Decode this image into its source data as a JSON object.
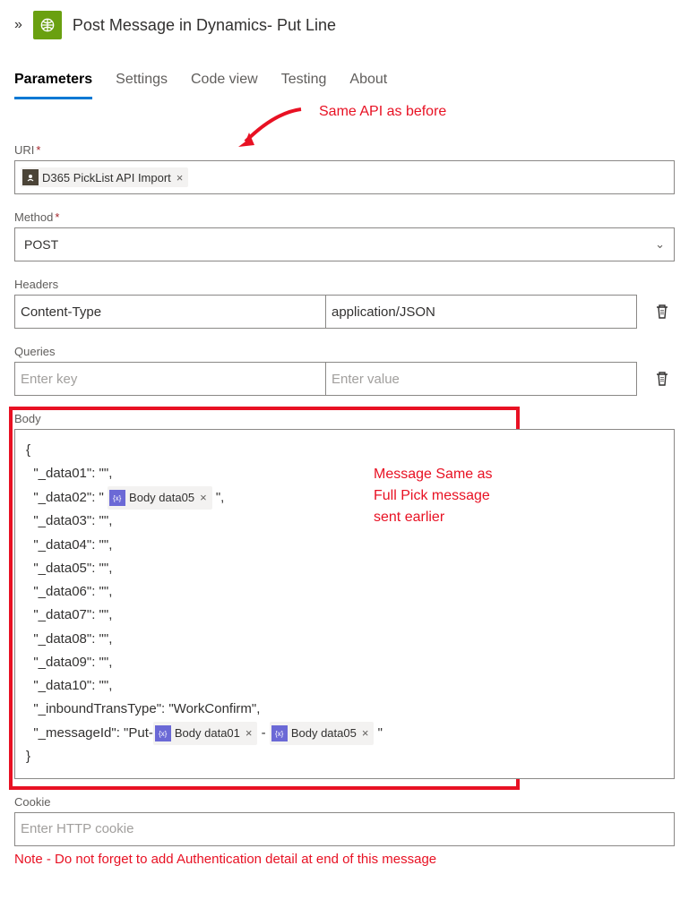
{
  "header": {
    "title": "Post Message in Dynamics- Put Line"
  },
  "tabs": [
    {
      "label": "Parameters",
      "active": true
    },
    {
      "label": "Settings",
      "active": false
    },
    {
      "label": "Code view",
      "active": false
    },
    {
      "label": "Testing",
      "active": false
    },
    {
      "label": "About",
      "active": false
    }
  ],
  "annotations": {
    "top": "Same API as before",
    "bodyLine1": "Message Same as",
    "bodyLine2": "Full Pick message",
    "bodyLine3": "sent earlier",
    "note": "Note - Do not forget to add Authentication detail at end of this message"
  },
  "fields": {
    "uri": {
      "label": "URI",
      "token": "D365 PickList API Import"
    },
    "method": {
      "label": "Method",
      "value": "POST"
    },
    "headers": {
      "label": "Headers",
      "key": "Content-Type",
      "value": "application/JSON"
    },
    "queries": {
      "label": "Queries",
      "keyPlaceholder": "Enter key",
      "valuePlaceholder": "Enter value"
    },
    "body": {
      "label": "Body",
      "lines": [
        "{",
        "  \"_data01\": \"\",",
        "  \"_data02\": \" ",
        "  \"_data03\": \"\",",
        "  \"_data04\": \"\",",
        "  \"_data05\": \"\",",
        "  \"_data06\": \"\",",
        "  \"_data07\": \"\",",
        "  \"_data08\": \"\",",
        "  \"_data09\": \"\",",
        "  \"_data10\": \"\",",
        "  \"_inboundTransType\": \"WorkConfirm\",",
        "  \"_messageId\": \"Put-",
        "}"
      ],
      "tokens": {
        "data02": "Body data05",
        "msgIdA": "Body data01",
        "msgIdB": "Body data05",
        "afterData02Close": " \",",
        "dash": " - ",
        "afterMsgClose": " \""
      }
    },
    "cookie": {
      "label": "Cookie",
      "placeholder": "Enter HTTP cookie"
    }
  }
}
